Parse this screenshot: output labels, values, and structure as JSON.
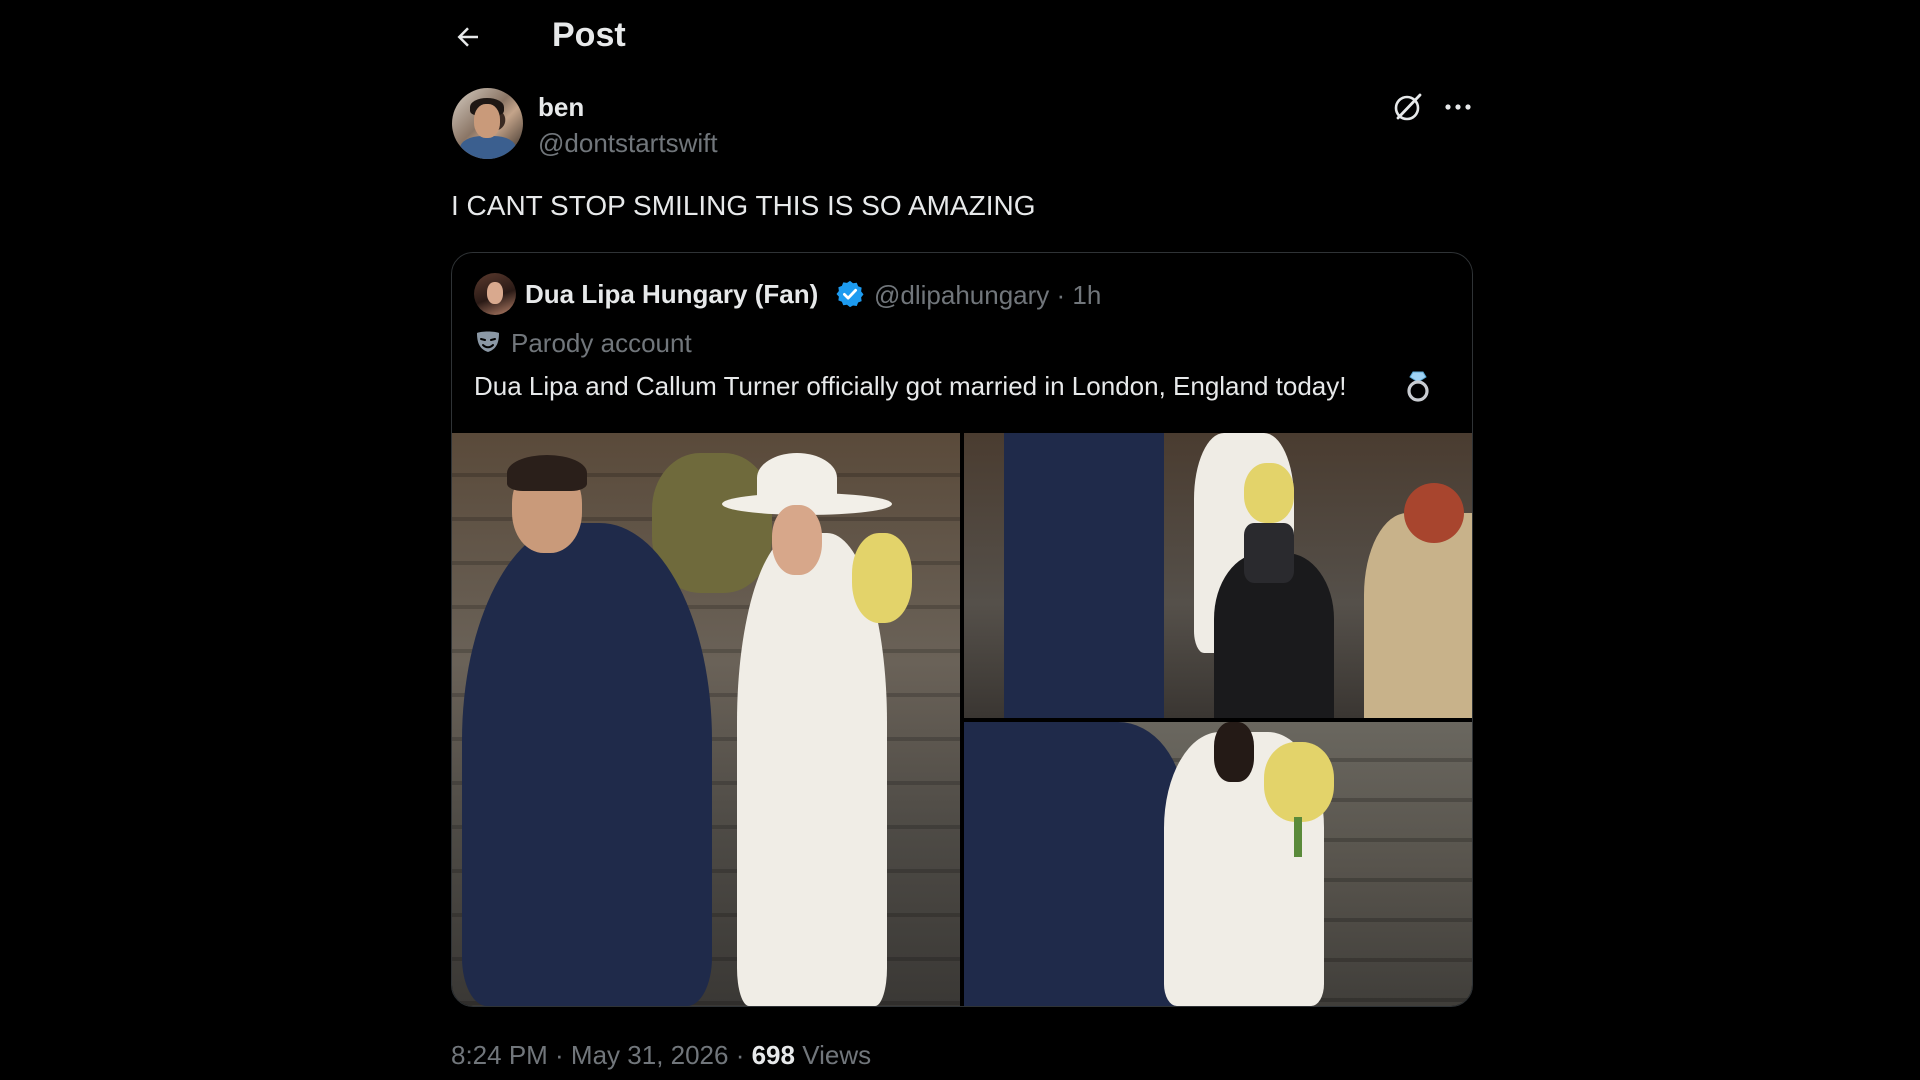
{
  "header": {
    "title": "Post",
    "back_icon": "arrow-left-icon"
  },
  "post": {
    "author": {
      "display_name": "ben",
      "handle": "@dontstartswift"
    },
    "actions": {
      "grok_icon": "grok-icon",
      "more_icon": "more-horizontal-icon"
    },
    "text": "I CANT STOP SMILING THIS IS SO AMAZING",
    "quoted": {
      "display_name": "Dua Lipa Hungary (Fan)",
      "verified_icon": "verified-badge-icon",
      "handle_time": "@dlipahungary · 1h",
      "label_icon": "parody-mask-icon",
      "label": "Parody account",
      "text": "Dua Lipa and Callum Turner officially got married in London, England today!",
      "emoji_icon": "ring-emoji-icon",
      "media": [
        {
          "icon": "photo-couple-leaving-steps"
        },
        {
          "icon": "photo-photographers-crowd"
        },
        {
          "icon": "photo-bride-with-bouquet"
        }
      ]
    },
    "meta": {
      "time_date": "8:24 PM · May 31, 2026 · ",
      "views_count": "698",
      "views_label": " Views"
    }
  },
  "colors": {
    "background": "#000000",
    "text": "#e7e9ea",
    "secondary": "#71767b",
    "border": "#2f3336",
    "verified": "#1d9bf0"
  }
}
